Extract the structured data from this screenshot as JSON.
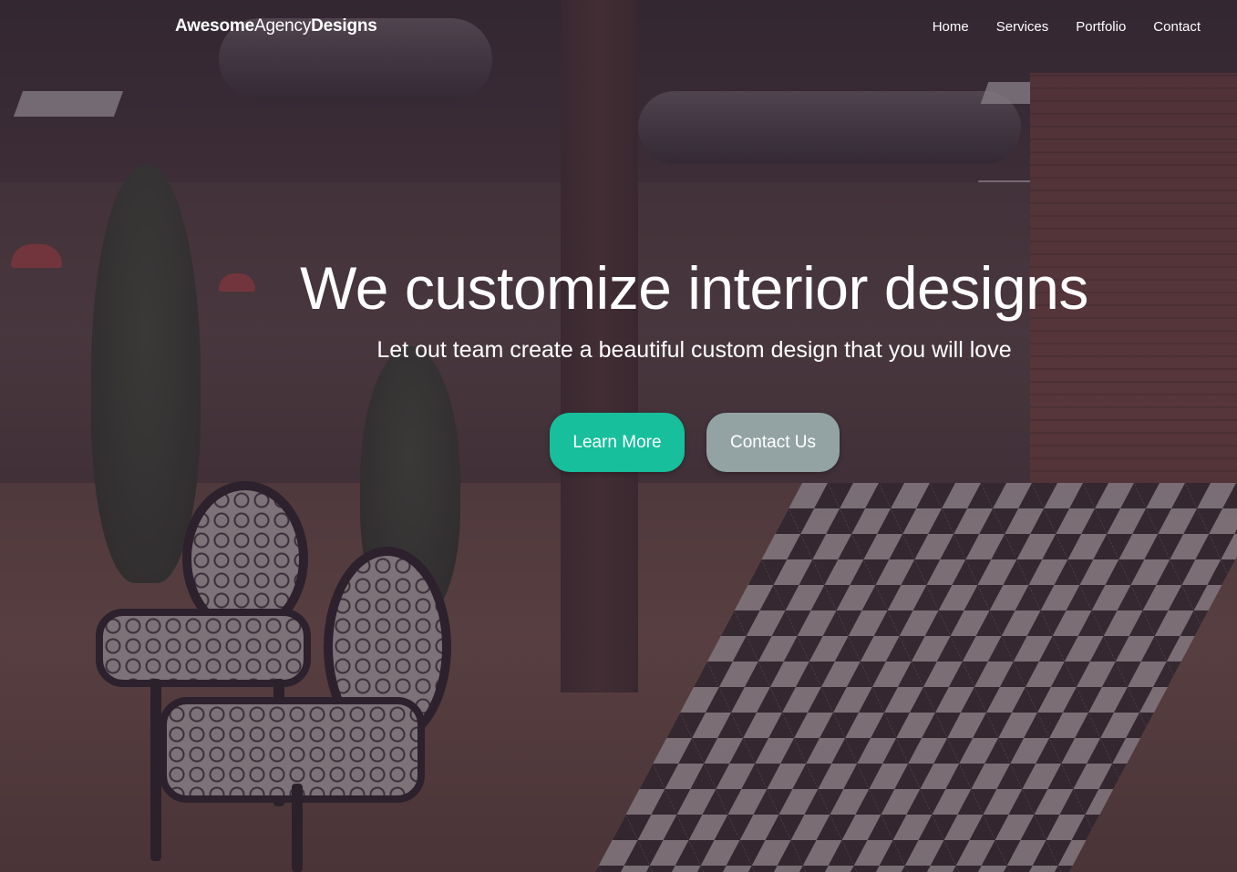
{
  "brand": {
    "bold_part1": "Awesome",
    "light_part": "Agency",
    "bold_part2": "Designs"
  },
  "nav": {
    "items": [
      {
        "label": "Home"
      },
      {
        "label": "Services"
      },
      {
        "label": "Portfolio"
      },
      {
        "label": "Contact"
      }
    ]
  },
  "hero": {
    "title": "We customize interior designs",
    "subtitle": "Let out team create a beautiful custom design that you will love",
    "primary_button": "Learn More",
    "secondary_button": "Contact Us"
  },
  "colors": {
    "primary_button": "#17bf9c",
    "secondary_button": "#93a3a4",
    "overlay": "#3a2c3c",
    "text": "#ffffff"
  }
}
